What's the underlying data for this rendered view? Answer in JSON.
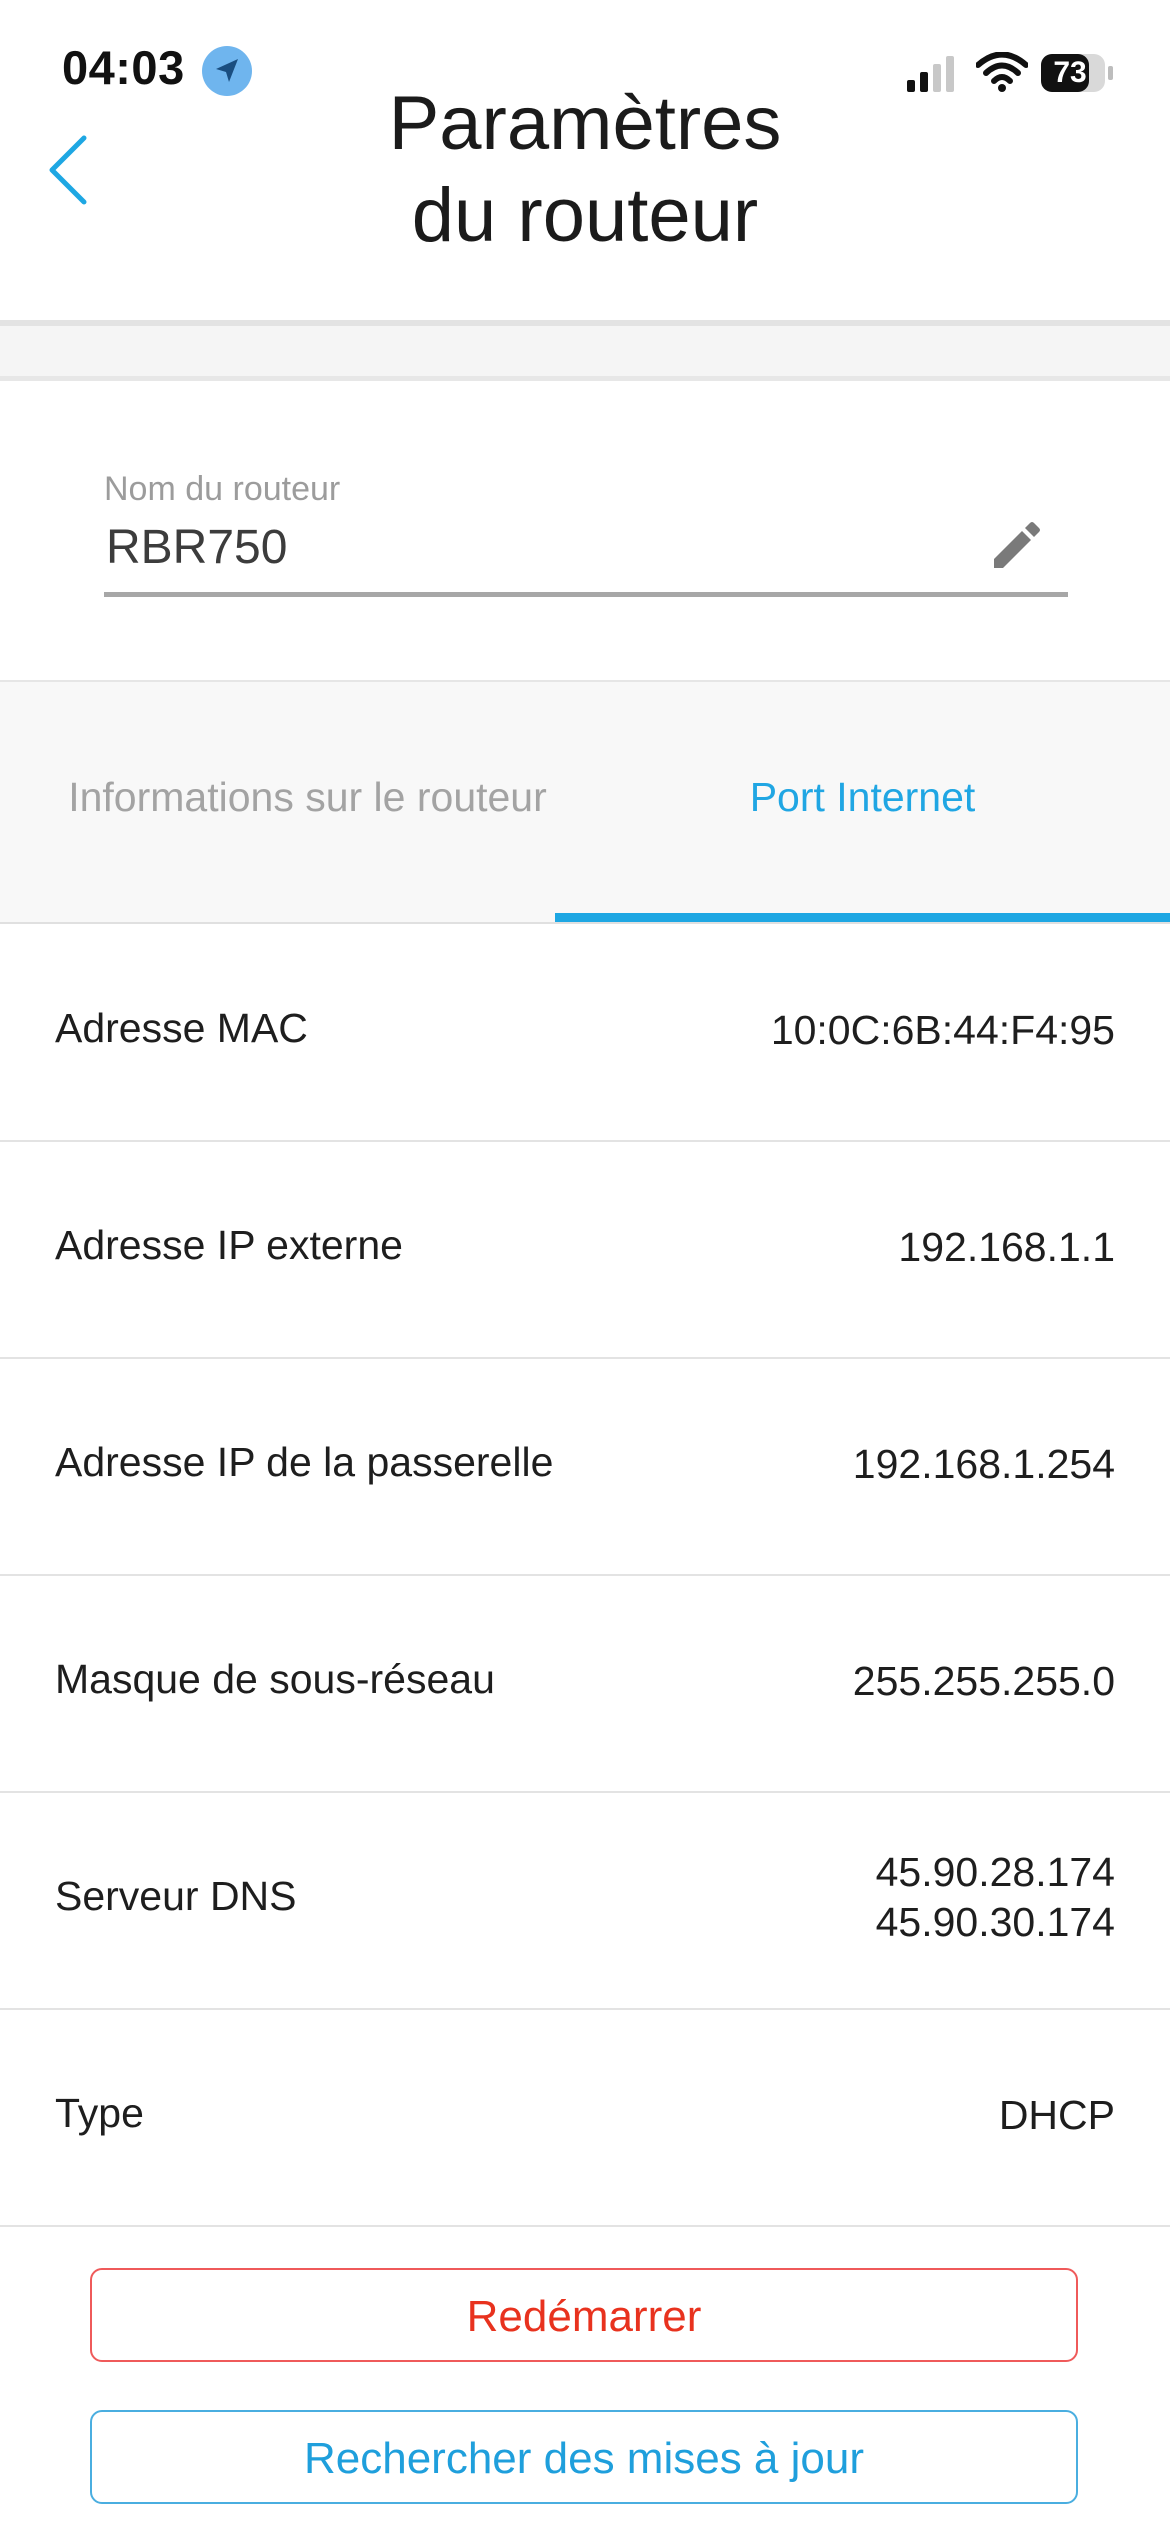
{
  "status_bar": {
    "time": "04:03",
    "battery": "73",
    "icons": [
      "location-arrow-icon",
      "cellular-signal-icon",
      "wifi-icon",
      "battery-icon"
    ]
  },
  "header": {
    "back_icon": "chevron-left-icon",
    "title_line1": "Paramètres",
    "title_line2": "du routeur"
  },
  "name_field": {
    "label": "Nom du routeur",
    "value": "RBR750",
    "edit_icon": "pencil-icon"
  },
  "tabs": [
    {
      "label": "Informations sur le routeur",
      "active": false
    },
    {
      "label": "Port Internet",
      "active": true
    }
  ],
  "rows": [
    {
      "label": "Adresse MAC",
      "value": "10:0C:6B:44:F4:95"
    },
    {
      "label": "Adresse IP externe",
      "value": "192.168.1.1"
    },
    {
      "label": "Adresse IP de la passerelle",
      "value": "192.168.1.254"
    },
    {
      "label": "Masque de sous-réseau",
      "value": "255.255.255.0"
    },
    {
      "label": "Serveur DNS",
      "value": "45.90.28.174",
      "value2": "45.90.30.174"
    },
    {
      "label": "Type",
      "value": "DHCP"
    }
  ],
  "buttons": {
    "restart": "Redémarrer",
    "check_updates": "Rechercher des mises à jour"
  },
  "colors": {
    "accent": "#1ea7e3",
    "danger": "#e8321e",
    "muted": "#a3a3a3"
  }
}
